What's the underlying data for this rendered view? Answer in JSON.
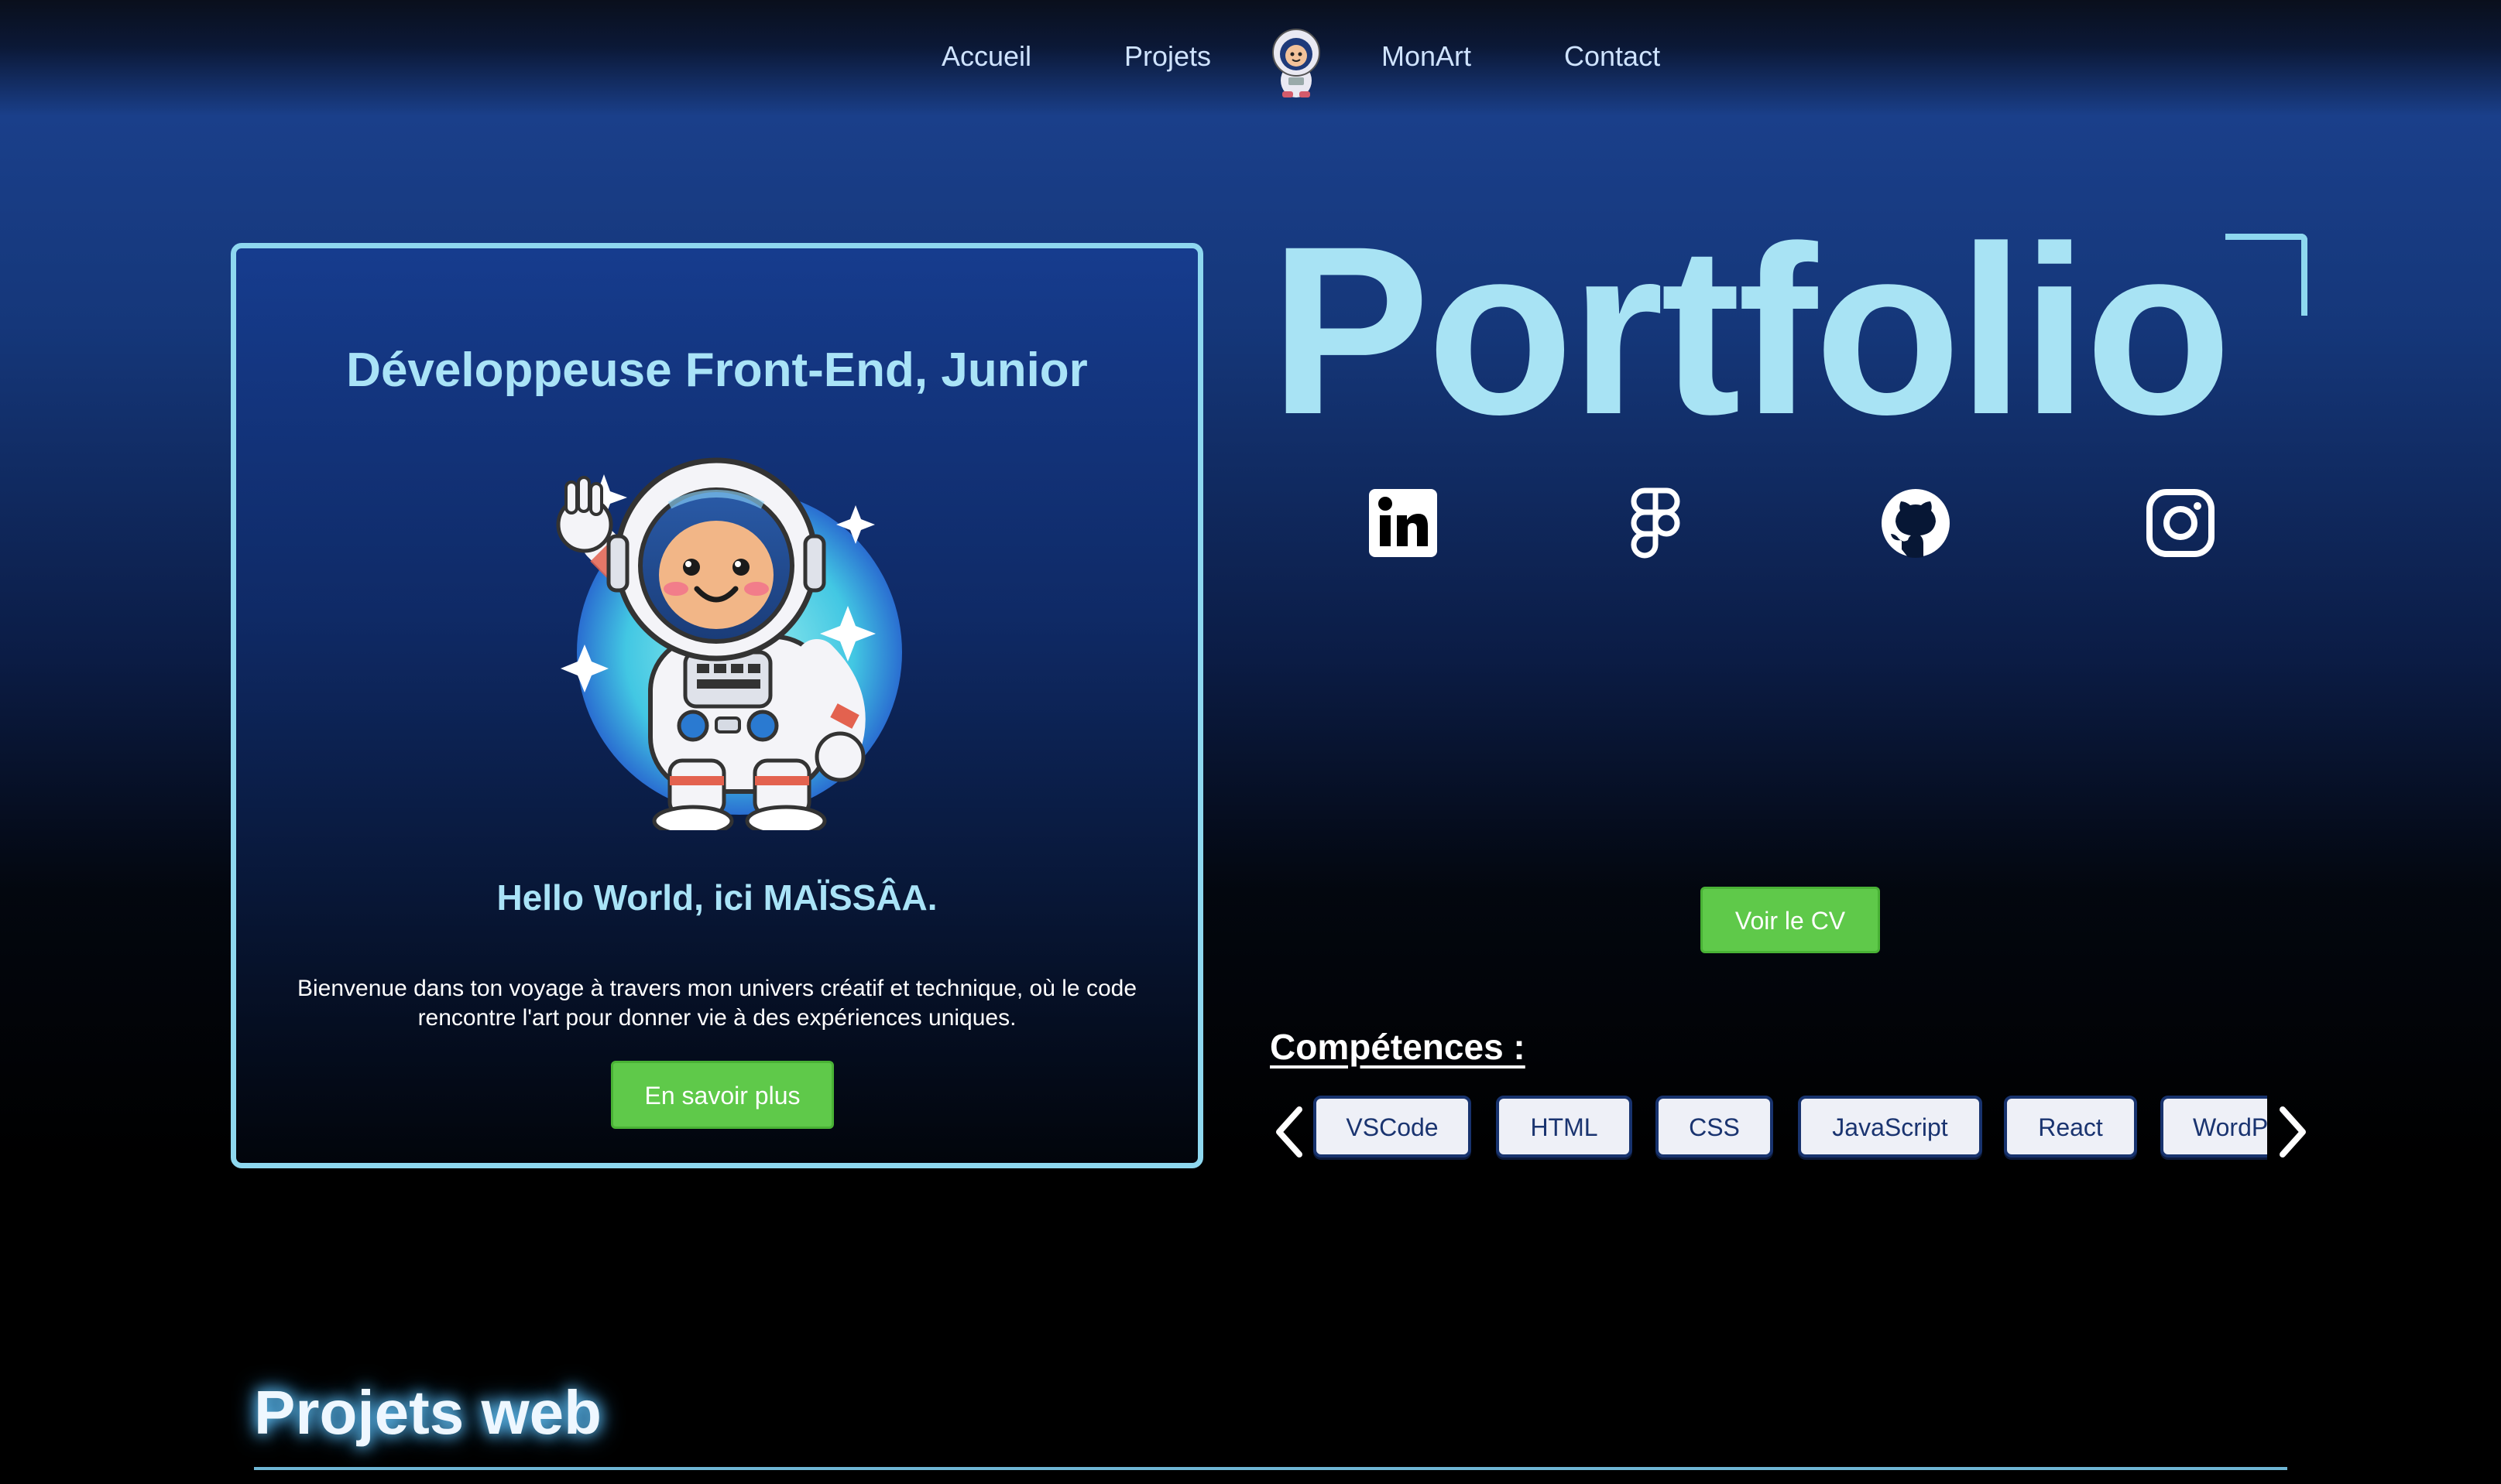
{
  "nav": {
    "links": [
      "Accueil",
      "Projets",
      "MonArt",
      "Contact"
    ],
    "logo_icon": "astronaut-avatar-icon"
  },
  "intro": {
    "title": "Développeuse Front-End, Junior",
    "illustration": "astronaut-waving-icon",
    "hello": "Hello World, ici MAÏSSÂA.",
    "text_line1": "Bienvenue dans ton voyage à travers mon univers créatif et technique, où le code",
    "text_line2": "rencontre l'art pour donner vie à des expériences uniques.",
    "button": "En savoir plus"
  },
  "hero": {
    "title": "Portfolio",
    "socials": [
      "linkedin-icon",
      "figma-icon",
      "github-icon",
      "instagram-icon"
    ],
    "cv_button": "Voir le CV"
  },
  "skills": {
    "title": "Compétences :",
    "items": [
      "VSCode",
      "HTML",
      "CSS",
      "JavaScript",
      "React",
      "WordP"
    ]
  },
  "projects": {
    "title": "Projets web"
  },
  "colors": {
    "accent": "#a8e3f4",
    "button_green": "#5fc94a",
    "chip_border": "#18336e"
  }
}
